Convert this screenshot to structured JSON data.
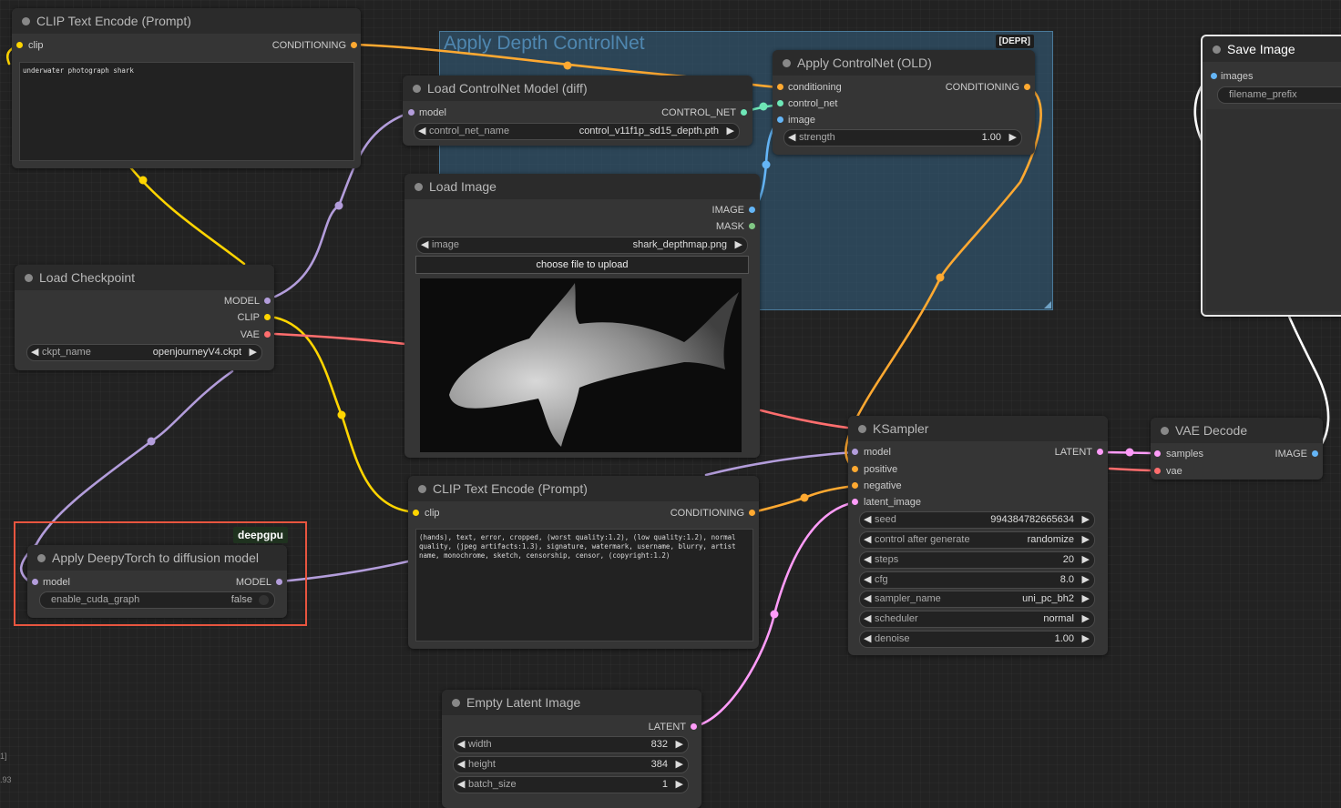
{
  "colors": {
    "clip": "#ffd500",
    "conditioning": "#ffa931",
    "model": "#b39ddb",
    "vae": "#ff6e6e",
    "image": "#64b5f6",
    "latent": "#ff9cf9",
    "control_net": "#6ee7b7",
    "mask": "#81c784"
  },
  "group_depth": {
    "title": "Apply Depth ControlNet",
    "badge": "[DEPR]"
  },
  "clip_text_top": {
    "title": "CLIP Text Encode (Prompt)",
    "input_clip": "clip",
    "output": "CONDITIONING",
    "text": "underwater photograph shark"
  },
  "load_controlnet": {
    "title": "Load ControlNet Model (diff)",
    "input_model": "model",
    "output": "CONTROL_NET",
    "widget_label": "control_net_name",
    "widget_value": "control_v11f1p_sd15_depth.pth"
  },
  "apply_controlnet": {
    "title": "Apply ControlNet (OLD)",
    "in_conditioning": "conditioning",
    "in_control_net": "control_net",
    "in_image": "image",
    "output": "CONDITIONING",
    "widget_label": "strength",
    "widget_value": "1.00"
  },
  "save_image": {
    "title": "Save Image",
    "input_images": "images",
    "widget_label": "filename_prefix"
  },
  "load_image": {
    "title": "Load Image",
    "out_image": "IMAGE",
    "out_mask": "MASK",
    "widget_label": "image",
    "widget_value": "shark_depthmap.png",
    "upload_label": "choose file to upload"
  },
  "load_checkpoint": {
    "title": "Load Checkpoint",
    "out_model": "MODEL",
    "out_clip": "CLIP",
    "out_vae": "VAE",
    "widget_label": "ckpt_name",
    "widget_value": "openjourneyV4.ckpt"
  },
  "deepy": {
    "badge": "deepgpu",
    "title": "Apply DeepyTorch to diffusion model",
    "input_model": "model",
    "output": "MODEL",
    "widget_label": "enable_cuda_graph",
    "widget_value": "false"
  },
  "clip_text_bottom": {
    "title": "CLIP Text Encode (Prompt)",
    "input_clip": "clip",
    "output": "CONDITIONING",
    "text": "(hands), text, error, cropped, (worst quality:1.2), (low quality:1.2), normal quality, (jpeg artifacts:1.3), signature, watermark, username, blurry, artist name, monochrome, sketch, censorship, censor, (copyright:1.2)"
  },
  "ksampler": {
    "title": "KSampler",
    "in_model": "model",
    "in_positive": "positive",
    "in_negative": "negative",
    "in_latent": "latent_image",
    "output": "LATENT",
    "widgets": [
      {
        "label": "seed",
        "value": "994384782665634"
      },
      {
        "label": "control after generate",
        "value": "randomize"
      },
      {
        "label": "steps",
        "value": "20"
      },
      {
        "label": "cfg",
        "value": "8.0"
      },
      {
        "label": "sampler_name",
        "value": "uni_pc_bh2"
      },
      {
        "label": "scheduler",
        "value": "normal"
      },
      {
        "label": "denoise",
        "value": "1.00"
      }
    ]
  },
  "vae_decode": {
    "title": "VAE Decode",
    "in_samples": "samples",
    "in_vae": "vae",
    "output": "IMAGE"
  },
  "empty_latent": {
    "title": "Empty Latent Image",
    "output": "LATENT",
    "widgets": [
      {
        "label": "width",
        "value": "832"
      },
      {
        "label": "height",
        "value": "384"
      },
      {
        "label": "batch_size",
        "value": "1"
      }
    ]
  },
  "edge_fragments": {
    "a": "1]",
    "b": ".93"
  }
}
